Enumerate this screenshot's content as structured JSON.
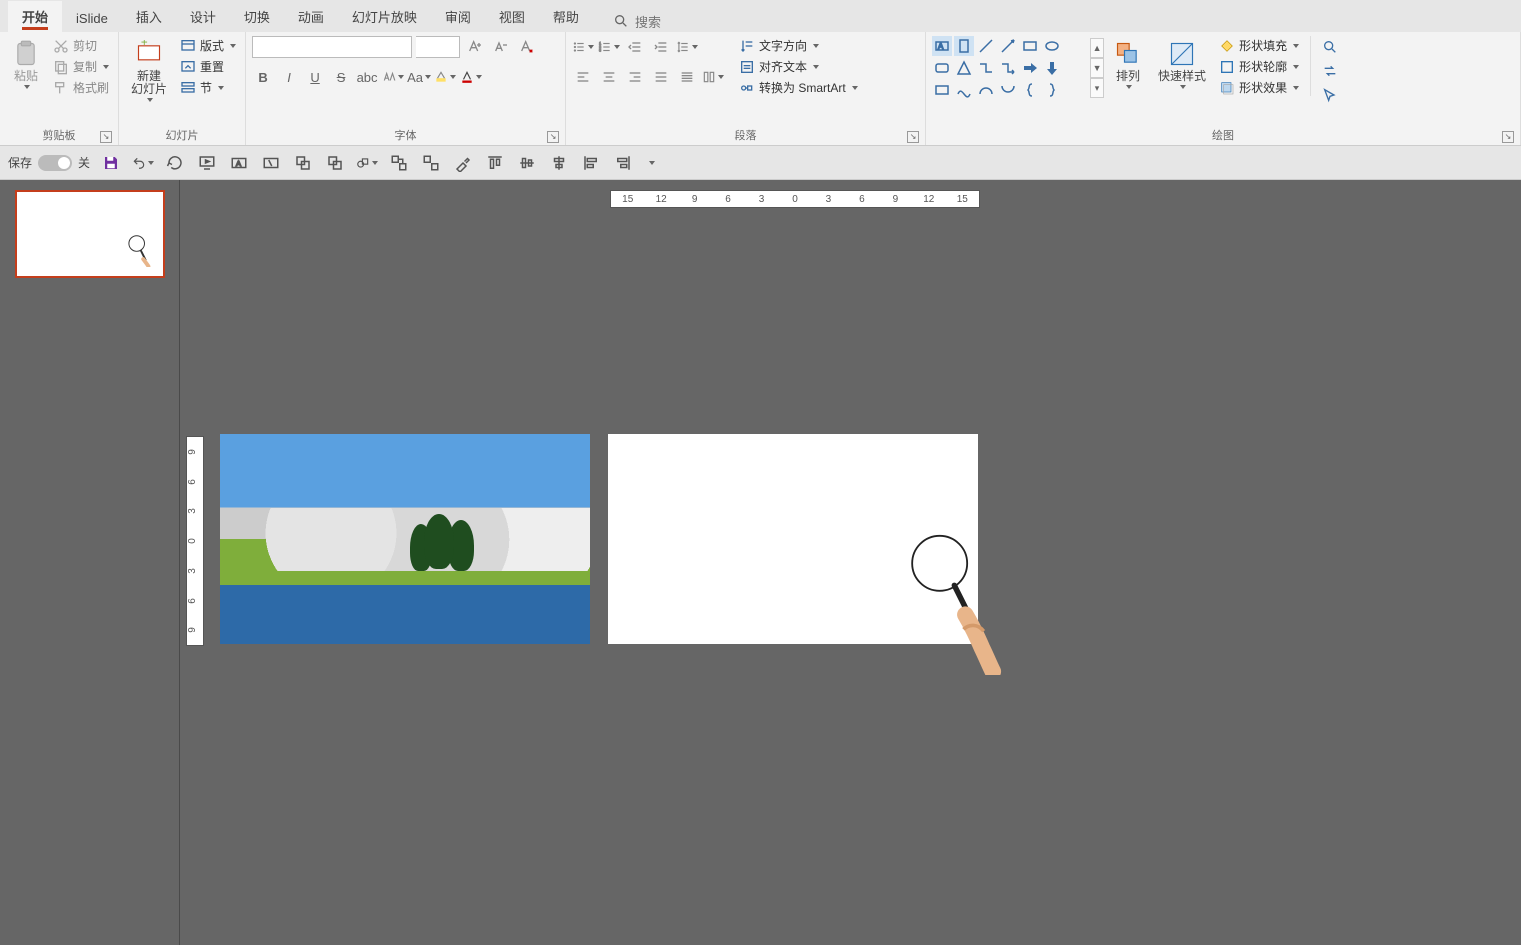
{
  "tabs": {
    "items": [
      "开始",
      "iSlide",
      "插入",
      "设计",
      "切换",
      "动画",
      "幻灯片放映",
      "审阅",
      "视图",
      "帮助"
    ],
    "active_index": 0,
    "search_placeholder": "搜索"
  },
  "ribbon": {
    "clipboard": {
      "label": "剪贴板",
      "cut": "剪切",
      "copy": "复制",
      "format_painter": "格式刷",
      "paste": "粘贴"
    },
    "slides": {
      "label": "幻灯片",
      "new_slide": "新建\n幻灯片",
      "layout": "版式",
      "reset": "重置",
      "section": "节"
    },
    "font": {
      "label": "字体"
    },
    "paragraph": {
      "label": "段落",
      "text_direction": "文字方向",
      "align_text": "对齐文本",
      "convert_smartart": "转换为 SmartArt"
    },
    "drawing": {
      "label": "绘图",
      "arrange": "排列",
      "quick_styles": "快速样式",
      "shape_fill": "形状填充",
      "shape_outline": "形状轮廓",
      "shape_effects": "形状效果"
    }
  },
  "qat": {
    "autosave_label": "保存",
    "autosave_state": "关"
  },
  "ruler_h": [
    "15",
    "12",
    "9",
    "6",
    "3",
    "0",
    "3",
    "6",
    "9",
    "12",
    "15"
  ],
  "ruler_v": [
    "9",
    "6",
    "3",
    "0",
    "3",
    "6",
    "9"
  ]
}
